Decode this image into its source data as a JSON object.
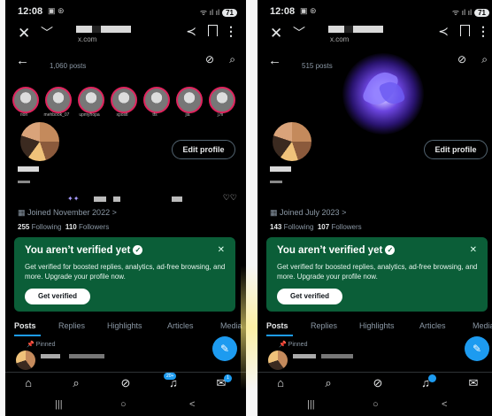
{
  "status_bar": {
    "time": "12:08",
    "battery": "71"
  },
  "url_bar": {
    "domain": "x.com"
  },
  "screens": [
    {
      "post_count": "1,060 posts",
      "edit_profile_label": "Edit profile",
      "joined": "Joined November 2022",
      "following_count": "255",
      "following_label": "Following",
      "followers_count": "110",
      "followers_label": "Followers",
      "stories": [
        "rion",
        "mehbook_07",
        "upmyhopa",
        "xpostl",
        "tfs",
        "jia",
        "j.m"
      ]
    },
    {
      "post_count": "515 posts",
      "edit_profile_label": "Edit profile",
      "joined": "Joined July 2023",
      "following_count": "143",
      "following_label": "Following",
      "followers_count": "107",
      "followers_label": "Followers"
    }
  ],
  "verify_card": {
    "title": "You aren’t verified yet",
    "description": "Get verified for boosted replies, analytics, ad-free browsing, and more. Upgrade your profile now.",
    "cta": "Get verified",
    "accent_color": "#0b5e38"
  },
  "tabs": [
    "Posts",
    "Replies",
    "Highlights",
    "Articles",
    "Media"
  ],
  "pinned_label": "Pinned",
  "nav_badges": {
    "left_notifications": "20+",
    "messages": "1"
  },
  "colors": {
    "background": "#000000",
    "accent": "#1d9bf0",
    "muted_text": "#8b98a5"
  },
  "icons": [
    "close-icon",
    "chevron-down-icon",
    "share-icon",
    "bookmark-icon",
    "more-icon",
    "back-arrow-icon",
    "grok-icon",
    "search-icon",
    "home-icon",
    "notifications-icon",
    "messages-icon",
    "compose-icon"
  ]
}
